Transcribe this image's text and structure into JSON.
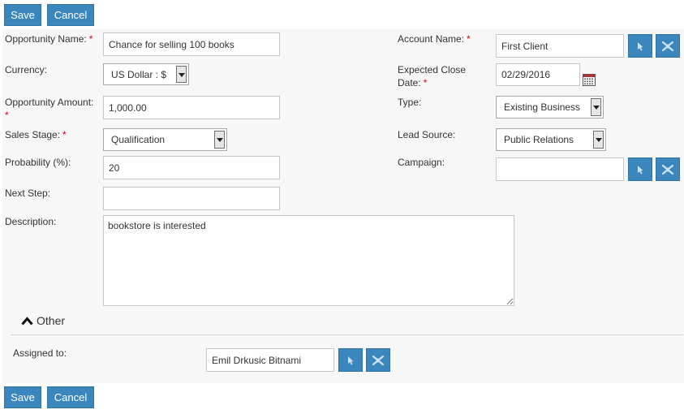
{
  "toolbar": {
    "save_label": "Save",
    "cancel_label": "Cancel"
  },
  "fields": {
    "opportunity_name": {
      "label": "Opportunity Name:",
      "required": "*",
      "value": "Chance for selling 100 books"
    },
    "currency": {
      "label": "Currency:",
      "value": "US Dollar : $"
    },
    "opportunity_amount": {
      "label": "Opportunity Amount:",
      "required": "*",
      "value": "1,000.00"
    },
    "sales_stage": {
      "label": "Sales Stage:",
      "required": "*",
      "value": "Qualification"
    },
    "probability": {
      "label": "Probability (%):",
      "value": "20"
    },
    "next_step": {
      "label": "Next Step:",
      "value": ""
    },
    "description": {
      "label": "Description:",
      "value": "bookstore is interested"
    },
    "account_name": {
      "label": "Account Name:",
      "required": "*",
      "value": "First Client"
    },
    "expected_close_date": {
      "label_line1": "Expected Close",
      "label_line2": "Date:",
      "required": "*",
      "value": "02/29/2016"
    },
    "type": {
      "label": "Type:",
      "value": "Existing Business"
    },
    "lead_source": {
      "label": "Lead Source:",
      "value": "Public Relations"
    },
    "campaign": {
      "label": "Campaign:",
      "value": ""
    }
  },
  "other_section": {
    "title": "Other",
    "assigned_to": {
      "label": "Assigned to:",
      "value": "Emil Drkusic Bitnami"
    }
  },
  "icons": {
    "select": "cursor-arrow-icon",
    "clear": "clear-x-icon",
    "calendar": "calendar-icon",
    "collapse": "chevron-up-icon"
  },
  "colors": {
    "button_bg": "#3b87bd",
    "required": "#d0021b",
    "panel_bg": "#f7f7f7"
  }
}
